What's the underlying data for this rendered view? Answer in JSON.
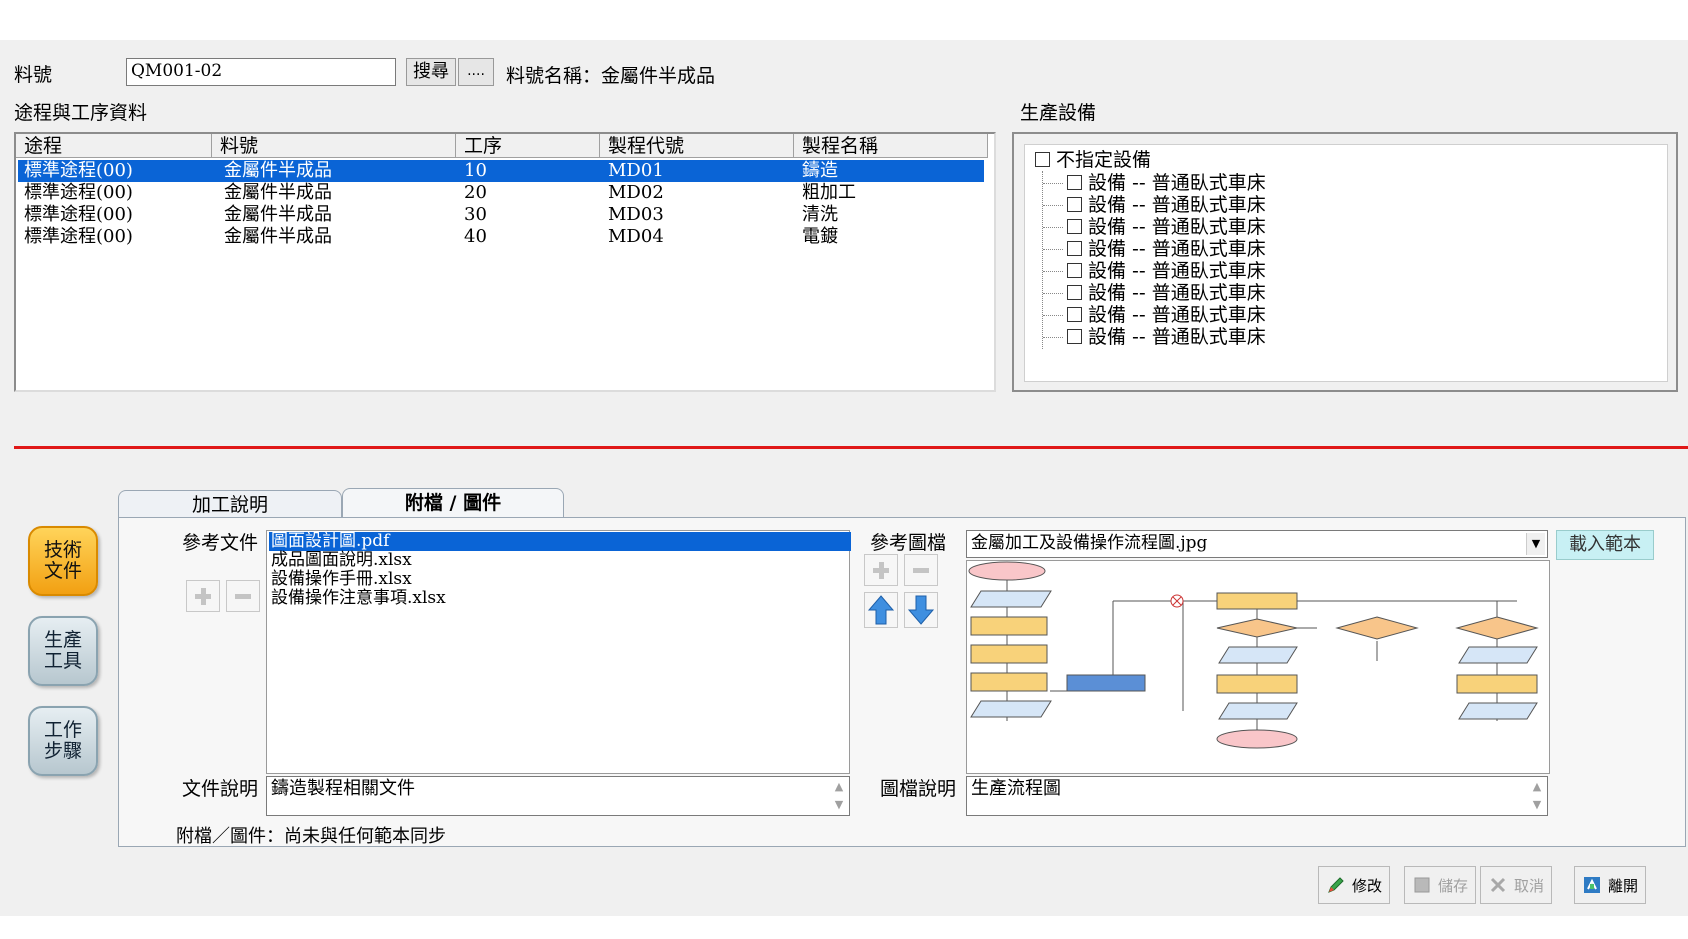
{
  "part": {
    "label": "料號",
    "value": "QM001-02",
    "search_label": "搜尋",
    "browse_label": "....",
    "name_label": "料號名稱：金屬件半成品"
  },
  "routing": {
    "section_title": "途程與工序資料",
    "columns": [
      "途程",
      "料號",
      "工序",
      "製程代號",
      "製程名稱"
    ],
    "rows": [
      {
        "route": "標準途程(00)",
        "part": "金屬件半成品",
        "seq": "10",
        "code": "MD01",
        "name": "鑄造",
        "selected": true
      },
      {
        "route": "標準途程(00)",
        "part": "金屬件半成品",
        "seq": "20",
        "code": "MD02",
        "name": "粗加工",
        "selected": false
      },
      {
        "route": "標準途程(00)",
        "part": "金屬件半成品",
        "seq": "30",
        "code": "MD03",
        "name": "清洗",
        "selected": false
      },
      {
        "route": "標準途程(00)",
        "part": "金屬件半成品",
        "seq": "40",
        "code": "MD04",
        "name": "電鍍",
        "selected": false
      }
    ]
  },
  "equipment": {
    "section_title": "生產設備",
    "root": "不指定設備",
    "items": [
      "設備 -- 普通臥式車床",
      "設備 -- 普通臥式車床",
      "設備 -- 普通臥式車床",
      "設備 -- 普通臥式車床",
      "設備 -- 普通臥式車床",
      "設備 -- 普通臥式車床",
      "設備 -- 普通臥式車床",
      "設備 -- 普通臥式車床"
    ]
  },
  "sidebar": {
    "btn1": "技術\n文件",
    "btn2": "生產\n工具",
    "btn3": "工作\n步驟"
  },
  "tabs": {
    "tab1": "加工說明",
    "tab2": "附檔 / 圖件"
  },
  "attachments": {
    "ref_doc_label": "參考文件",
    "files": [
      "圖面設計圖.pdf",
      "成品圖面說明.xlsx",
      "設備操作手冊.xlsx",
      "設備操作注意事項.xlsx"
    ],
    "doc_desc_label": "文件說明",
    "doc_desc_value": "鑄造製程相關文件",
    "status": "附檔／圖件：尚未與任何範本同步"
  },
  "images": {
    "ref_img_label": "參考圖檔",
    "selected_image": "金屬加工及設備操作流程圖.jpg",
    "load_template_label": "載入範本",
    "img_desc_label": "圖檔說明",
    "img_desc_value": "生產流程圖"
  },
  "footer": {
    "edit": "修改",
    "save": "儲存",
    "cancel": "取消",
    "exit": "離開"
  },
  "colors": {
    "selection": "#0a64d6",
    "divider": "#e01818",
    "side_active": "#f2a012",
    "load_button": "#c8f0f4"
  }
}
